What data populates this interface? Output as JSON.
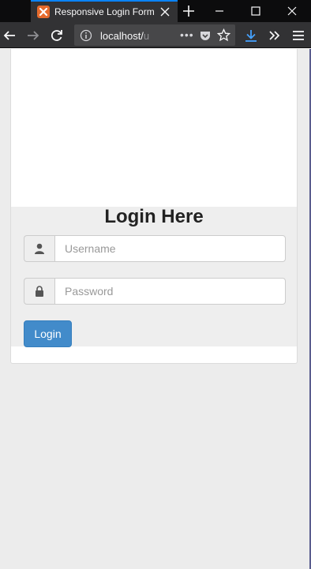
{
  "browser": {
    "tab_title": "Responsive Login Form",
    "url_host": "localhost/",
    "url_path_faded": "u",
    "url_more": "•••"
  },
  "login": {
    "heading": "Login Here",
    "username_placeholder": "Username",
    "password_placeholder": "Password",
    "button_label": "Login"
  },
  "colors": {
    "accent_tab": "#0a84ff",
    "button": "#428bca",
    "form_background": "#eeeeee"
  }
}
